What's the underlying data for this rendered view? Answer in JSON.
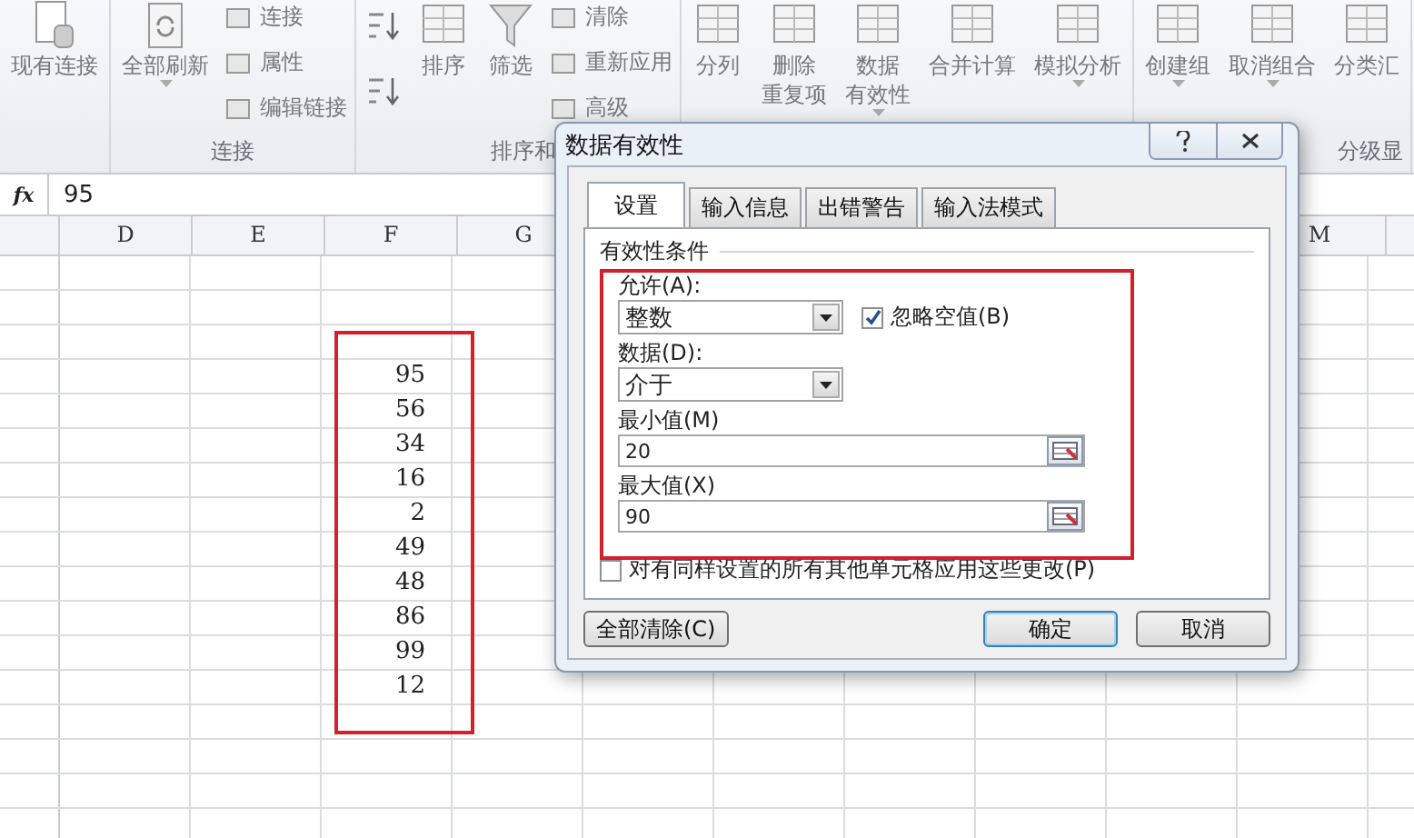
{
  "ribbon": {
    "groups": [
      {
        "columns": [
          {
            "kind": "large",
            "lines": [
              "现有连接"
            ],
            "dropdown": false
          }
        ]
      },
      {
        "label": "连接",
        "columns": [
          {
            "kind": "large",
            "lines": [
              "全部刷新"
            ],
            "dropdown": true
          },
          {
            "kind": "stack",
            "items": [
              {
                "label": "连接"
              },
              {
                "label": "属性"
              },
              {
                "label": "编辑链接"
              }
            ]
          }
        ]
      },
      {
        "label": "排序和",
        "columns": [
          {
            "kind": "sort-stack"
          },
          {
            "kind": "large",
            "lines": [
              "排序"
            ],
            "dropdown": false
          },
          {
            "kind": "large",
            "lines": [
              "筛选"
            ],
            "dropdown": false
          },
          {
            "kind": "stack",
            "items": [
              {
                "label": "清除"
              },
              {
                "label": "重新应用"
              },
              {
                "label": "高级"
              }
            ]
          }
        ]
      },
      {
        "columns": [
          {
            "kind": "large",
            "lines": [
              "分列"
            ],
            "dropdown": false
          },
          {
            "kind": "large",
            "lines": [
              "删除",
              "重复项"
            ],
            "dropdown": false
          },
          {
            "kind": "large",
            "lines": [
              "数据",
              "有效性"
            ],
            "dropdown": true
          },
          {
            "kind": "large",
            "lines": [
              "合并计算"
            ],
            "dropdown": false
          },
          {
            "kind": "large",
            "lines": [
              "模拟分析"
            ],
            "dropdown": true
          }
        ]
      },
      {
        "label": "分级显",
        "columns": [
          {
            "kind": "large",
            "lines": [
              "创建组"
            ],
            "dropdown": true
          },
          {
            "kind": "large",
            "lines": [
              "取消组合"
            ],
            "dropdown": true
          },
          {
            "kind": "large",
            "lines": [
              "分类汇"
            ],
            "dropdown": false
          }
        ]
      }
    ]
  },
  "formula_bar": {
    "fx_label": "fx",
    "value": "95"
  },
  "sheet": {
    "columns": [
      {
        "label": "D"
      },
      {
        "label": "E"
      },
      {
        "label": "F"
      },
      {
        "label": "G"
      },
      {
        "label": "M"
      }
    ],
    "f_values": [
      "95",
      "56",
      "34",
      "16",
      "2",
      "49",
      "48",
      "86",
      "99",
      "12"
    ]
  },
  "dialog": {
    "title": "数据有效性",
    "tabs": [
      {
        "label": "设置",
        "selected": true
      },
      {
        "label": "输入信息",
        "selected": false
      },
      {
        "label": "出错警告",
        "selected": false
      },
      {
        "label": "输入法模式",
        "selected": false
      }
    ],
    "section": "有效性条件",
    "fields": [
      {
        "kind": "select",
        "label": "允许(A):",
        "value": "整数"
      },
      {
        "kind": "select",
        "label": "数据(D):",
        "value": "介于"
      },
      {
        "kind": "range",
        "label": "最小值(M)",
        "value": "20"
      },
      {
        "kind": "range",
        "label": "最大值(X)",
        "value": "90"
      }
    ],
    "ignore_blank": {
      "label": "忽略空值(B)",
      "checked": true
    },
    "apply_all": {
      "label": "对有同样设置的所有其他单元格应用这些更改(P)",
      "checked": false
    },
    "buttons": [
      {
        "label": "全部清除(C)",
        "default": false
      },
      {
        "label": "确定",
        "default": true
      },
      {
        "label": "取消",
        "default": false
      }
    ]
  }
}
